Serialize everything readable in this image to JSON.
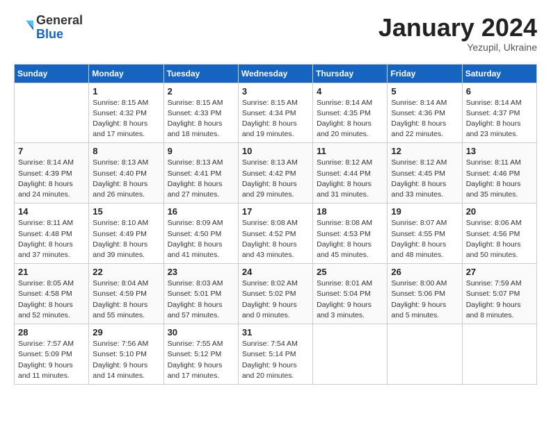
{
  "logo": {
    "general": "General",
    "blue": "Blue"
  },
  "header": {
    "month_year": "January 2024",
    "location": "Yezupil, Ukraine"
  },
  "weekdays": [
    "Sunday",
    "Monday",
    "Tuesday",
    "Wednesday",
    "Thursday",
    "Friday",
    "Saturday"
  ],
  "weeks": [
    [
      {
        "day": "",
        "sunrise": "",
        "sunset": "",
        "daylight": ""
      },
      {
        "day": "1",
        "sunrise": "Sunrise: 8:15 AM",
        "sunset": "Sunset: 4:32 PM",
        "daylight": "Daylight: 8 hours and 17 minutes."
      },
      {
        "day": "2",
        "sunrise": "Sunrise: 8:15 AM",
        "sunset": "Sunset: 4:33 PM",
        "daylight": "Daylight: 8 hours and 18 minutes."
      },
      {
        "day": "3",
        "sunrise": "Sunrise: 8:15 AM",
        "sunset": "Sunset: 4:34 PM",
        "daylight": "Daylight: 8 hours and 19 minutes."
      },
      {
        "day": "4",
        "sunrise": "Sunrise: 8:14 AM",
        "sunset": "Sunset: 4:35 PM",
        "daylight": "Daylight: 8 hours and 20 minutes."
      },
      {
        "day": "5",
        "sunrise": "Sunrise: 8:14 AM",
        "sunset": "Sunset: 4:36 PM",
        "daylight": "Daylight: 8 hours and 22 minutes."
      },
      {
        "day": "6",
        "sunrise": "Sunrise: 8:14 AM",
        "sunset": "Sunset: 4:37 PM",
        "daylight": "Daylight: 8 hours and 23 minutes."
      }
    ],
    [
      {
        "day": "7",
        "sunrise": "Sunrise: 8:14 AM",
        "sunset": "Sunset: 4:39 PM",
        "daylight": "Daylight: 8 hours and 24 minutes."
      },
      {
        "day": "8",
        "sunrise": "Sunrise: 8:13 AM",
        "sunset": "Sunset: 4:40 PM",
        "daylight": "Daylight: 8 hours and 26 minutes."
      },
      {
        "day": "9",
        "sunrise": "Sunrise: 8:13 AM",
        "sunset": "Sunset: 4:41 PM",
        "daylight": "Daylight: 8 hours and 27 minutes."
      },
      {
        "day": "10",
        "sunrise": "Sunrise: 8:13 AM",
        "sunset": "Sunset: 4:42 PM",
        "daylight": "Daylight: 8 hours and 29 minutes."
      },
      {
        "day": "11",
        "sunrise": "Sunrise: 8:12 AM",
        "sunset": "Sunset: 4:44 PM",
        "daylight": "Daylight: 8 hours and 31 minutes."
      },
      {
        "day": "12",
        "sunrise": "Sunrise: 8:12 AM",
        "sunset": "Sunset: 4:45 PM",
        "daylight": "Daylight: 8 hours and 33 minutes."
      },
      {
        "day": "13",
        "sunrise": "Sunrise: 8:11 AM",
        "sunset": "Sunset: 4:46 PM",
        "daylight": "Daylight: 8 hours and 35 minutes."
      }
    ],
    [
      {
        "day": "14",
        "sunrise": "Sunrise: 8:11 AM",
        "sunset": "Sunset: 4:48 PM",
        "daylight": "Daylight: 8 hours and 37 minutes."
      },
      {
        "day": "15",
        "sunrise": "Sunrise: 8:10 AM",
        "sunset": "Sunset: 4:49 PM",
        "daylight": "Daylight: 8 hours and 39 minutes."
      },
      {
        "day": "16",
        "sunrise": "Sunrise: 8:09 AM",
        "sunset": "Sunset: 4:50 PM",
        "daylight": "Daylight: 8 hours and 41 minutes."
      },
      {
        "day": "17",
        "sunrise": "Sunrise: 8:08 AM",
        "sunset": "Sunset: 4:52 PM",
        "daylight": "Daylight: 8 hours and 43 minutes."
      },
      {
        "day": "18",
        "sunrise": "Sunrise: 8:08 AM",
        "sunset": "Sunset: 4:53 PM",
        "daylight": "Daylight: 8 hours and 45 minutes."
      },
      {
        "day": "19",
        "sunrise": "Sunrise: 8:07 AM",
        "sunset": "Sunset: 4:55 PM",
        "daylight": "Daylight: 8 hours and 48 minutes."
      },
      {
        "day": "20",
        "sunrise": "Sunrise: 8:06 AM",
        "sunset": "Sunset: 4:56 PM",
        "daylight": "Daylight: 8 hours and 50 minutes."
      }
    ],
    [
      {
        "day": "21",
        "sunrise": "Sunrise: 8:05 AM",
        "sunset": "Sunset: 4:58 PM",
        "daylight": "Daylight: 8 hours and 52 minutes."
      },
      {
        "day": "22",
        "sunrise": "Sunrise: 8:04 AM",
        "sunset": "Sunset: 4:59 PM",
        "daylight": "Daylight: 8 hours and 55 minutes."
      },
      {
        "day": "23",
        "sunrise": "Sunrise: 8:03 AM",
        "sunset": "Sunset: 5:01 PM",
        "daylight": "Daylight: 8 hours and 57 minutes."
      },
      {
        "day": "24",
        "sunrise": "Sunrise: 8:02 AM",
        "sunset": "Sunset: 5:02 PM",
        "daylight": "Daylight: 9 hours and 0 minutes."
      },
      {
        "day": "25",
        "sunrise": "Sunrise: 8:01 AM",
        "sunset": "Sunset: 5:04 PM",
        "daylight": "Daylight: 9 hours and 3 minutes."
      },
      {
        "day": "26",
        "sunrise": "Sunrise: 8:00 AM",
        "sunset": "Sunset: 5:06 PM",
        "daylight": "Daylight: 9 hours and 5 minutes."
      },
      {
        "day": "27",
        "sunrise": "Sunrise: 7:59 AM",
        "sunset": "Sunset: 5:07 PM",
        "daylight": "Daylight: 9 hours and 8 minutes."
      }
    ],
    [
      {
        "day": "28",
        "sunrise": "Sunrise: 7:57 AM",
        "sunset": "Sunset: 5:09 PM",
        "daylight": "Daylight: 9 hours and 11 minutes."
      },
      {
        "day": "29",
        "sunrise": "Sunrise: 7:56 AM",
        "sunset": "Sunset: 5:10 PM",
        "daylight": "Daylight: 9 hours and 14 minutes."
      },
      {
        "day": "30",
        "sunrise": "Sunrise: 7:55 AM",
        "sunset": "Sunset: 5:12 PM",
        "daylight": "Daylight: 9 hours and 17 minutes."
      },
      {
        "day": "31",
        "sunrise": "Sunrise: 7:54 AM",
        "sunset": "Sunset: 5:14 PM",
        "daylight": "Daylight: 9 hours and 20 minutes."
      },
      {
        "day": "",
        "sunrise": "",
        "sunset": "",
        "daylight": ""
      },
      {
        "day": "",
        "sunrise": "",
        "sunset": "",
        "daylight": ""
      },
      {
        "day": "",
        "sunrise": "",
        "sunset": "",
        "daylight": ""
      }
    ]
  ]
}
